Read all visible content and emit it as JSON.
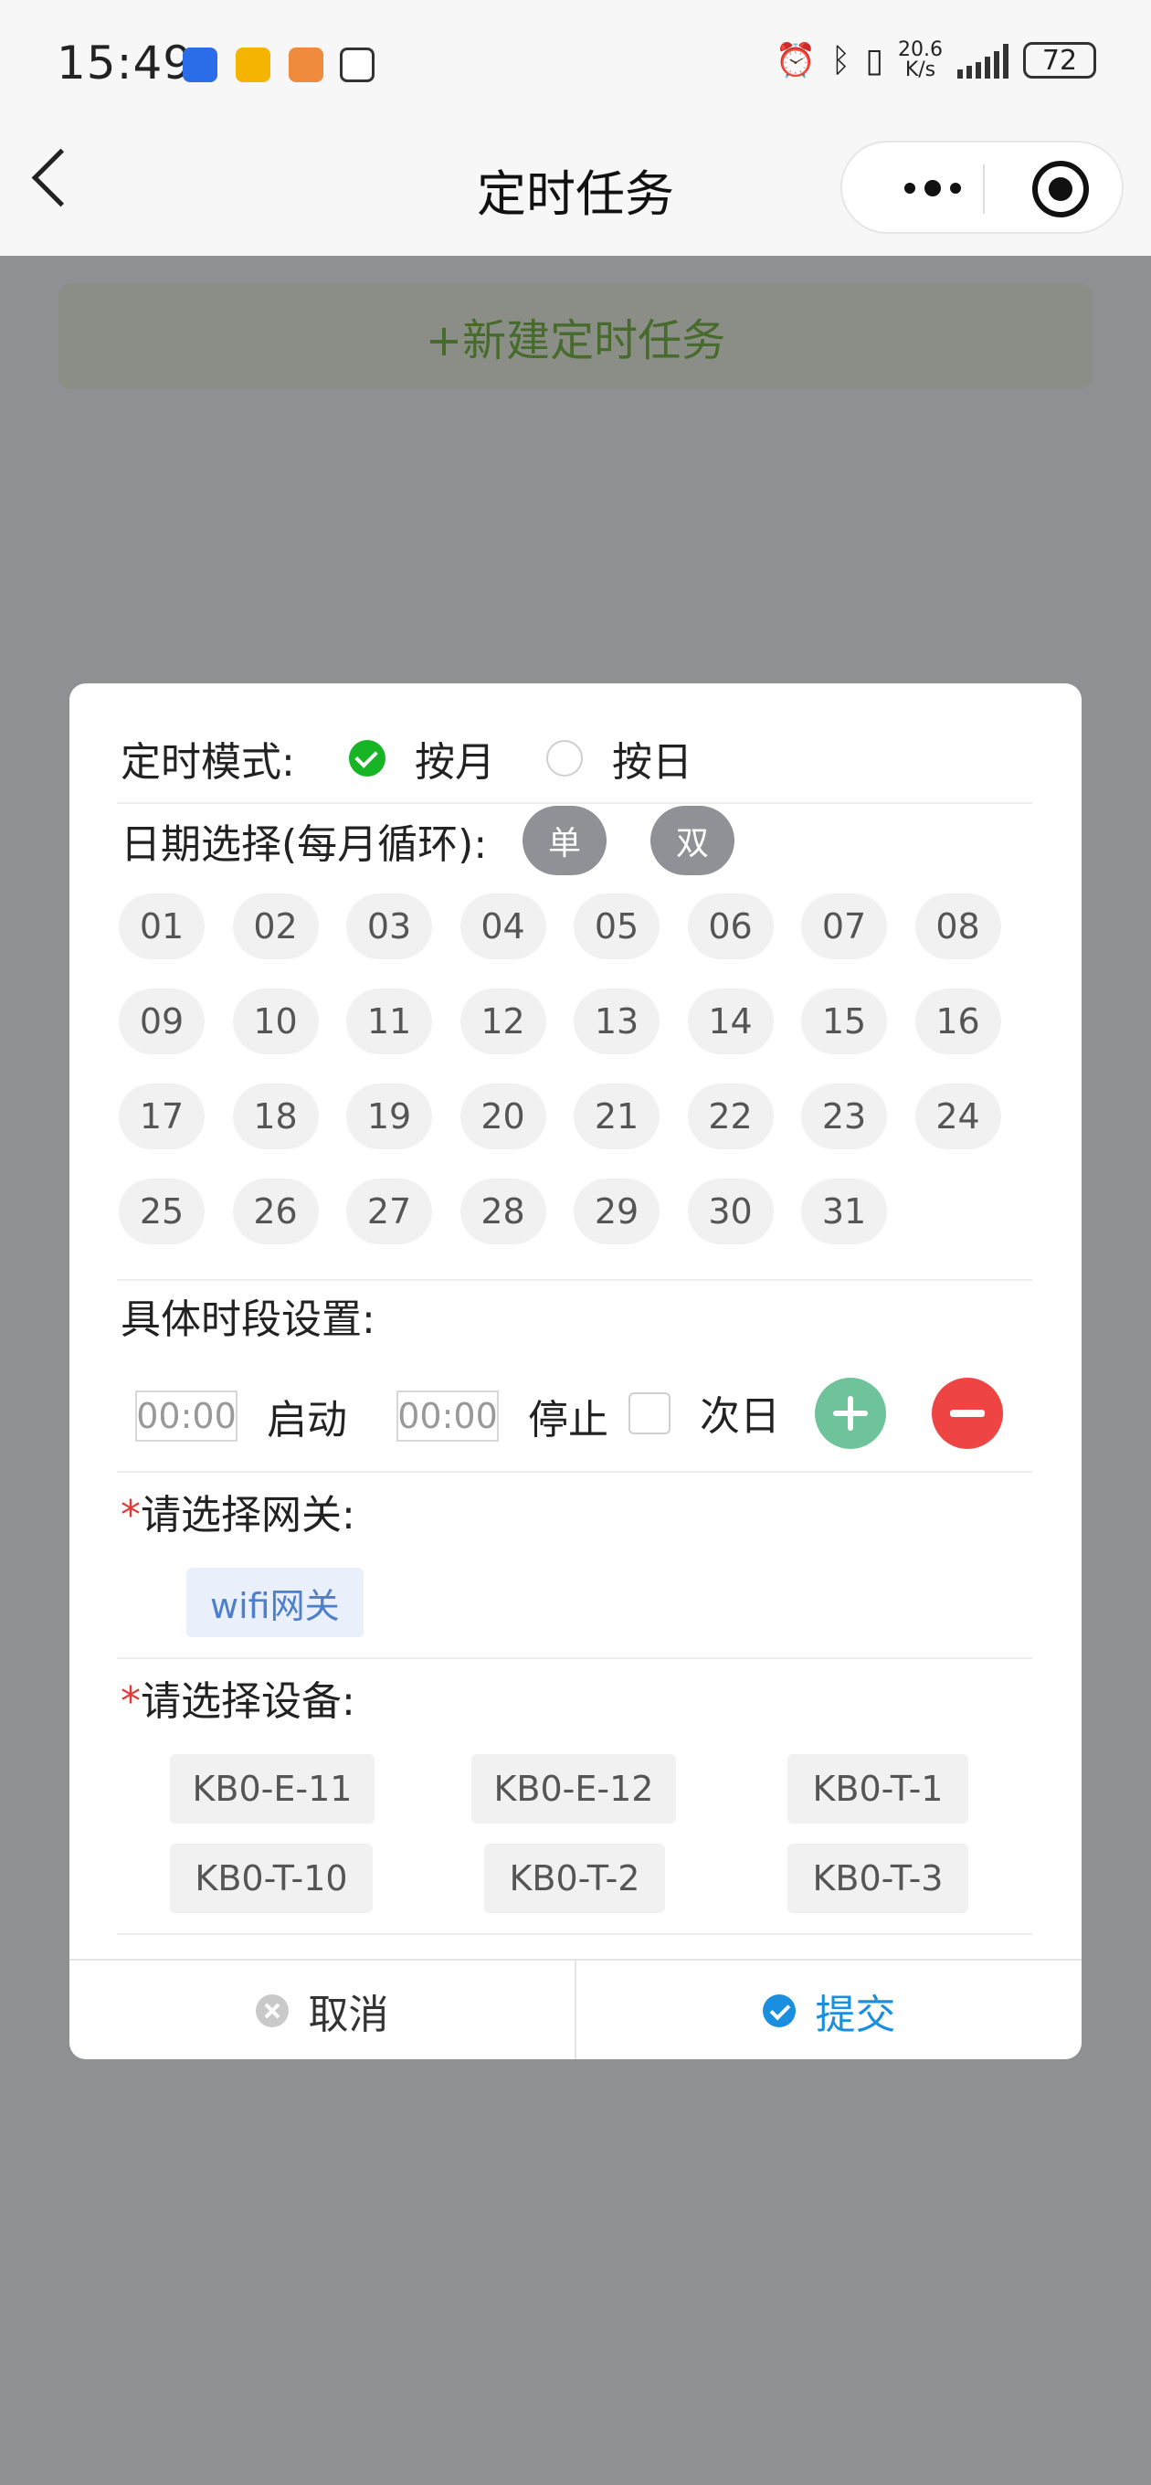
{
  "status_bar": {
    "time": "15:49",
    "net_speed_value": "20.6",
    "net_speed_unit": "K/s",
    "battery": "72"
  },
  "nav": {
    "title": "定时任务"
  },
  "new_task_button": "+新建定时任务",
  "modal": {
    "mode_label": "定时模式:",
    "mode_options": [
      "按月",
      "按日"
    ],
    "mode_selected": "按月",
    "date_label": "日期选择(每月循环):",
    "odd_label": "单",
    "even_label": "双",
    "days": [
      "01",
      "02",
      "03",
      "04",
      "05",
      "06",
      "07",
      "08",
      "09",
      "10",
      "11",
      "12",
      "13",
      "14",
      "15",
      "16",
      "17",
      "18",
      "19",
      "20",
      "21",
      "22",
      "23",
      "24",
      "25",
      "26",
      "27",
      "28",
      "29",
      "30",
      "31"
    ],
    "period_label": "具体时段设置:",
    "start_time": "00:00",
    "start_label": "启动",
    "stop_time": "00:00",
    "stop_label": "停止",
    "next_day_label": "次日",
    "required_mark": "*",
    "gateway_label": "请选择网关:",
    "gateway_option": "wifi网关",
    "device_label": "请选择设备:",
    "devices": [
      "KB0-E-11",
      "KB0-E-12",
      "KB0-T-1",
      "KB0-T-10",
      "KB0-T-2",
      "KB0-T-3"
    ],
    "cancel_label": "取消",
    "submit_label": "提交"
  },
  "colors": {
    "accent_green": "#17b426",
    "submit_blue": "#1a8fe0",
    "delete_red": "#ef4444",
    "add_green": "#6ec39a"
  }
}
